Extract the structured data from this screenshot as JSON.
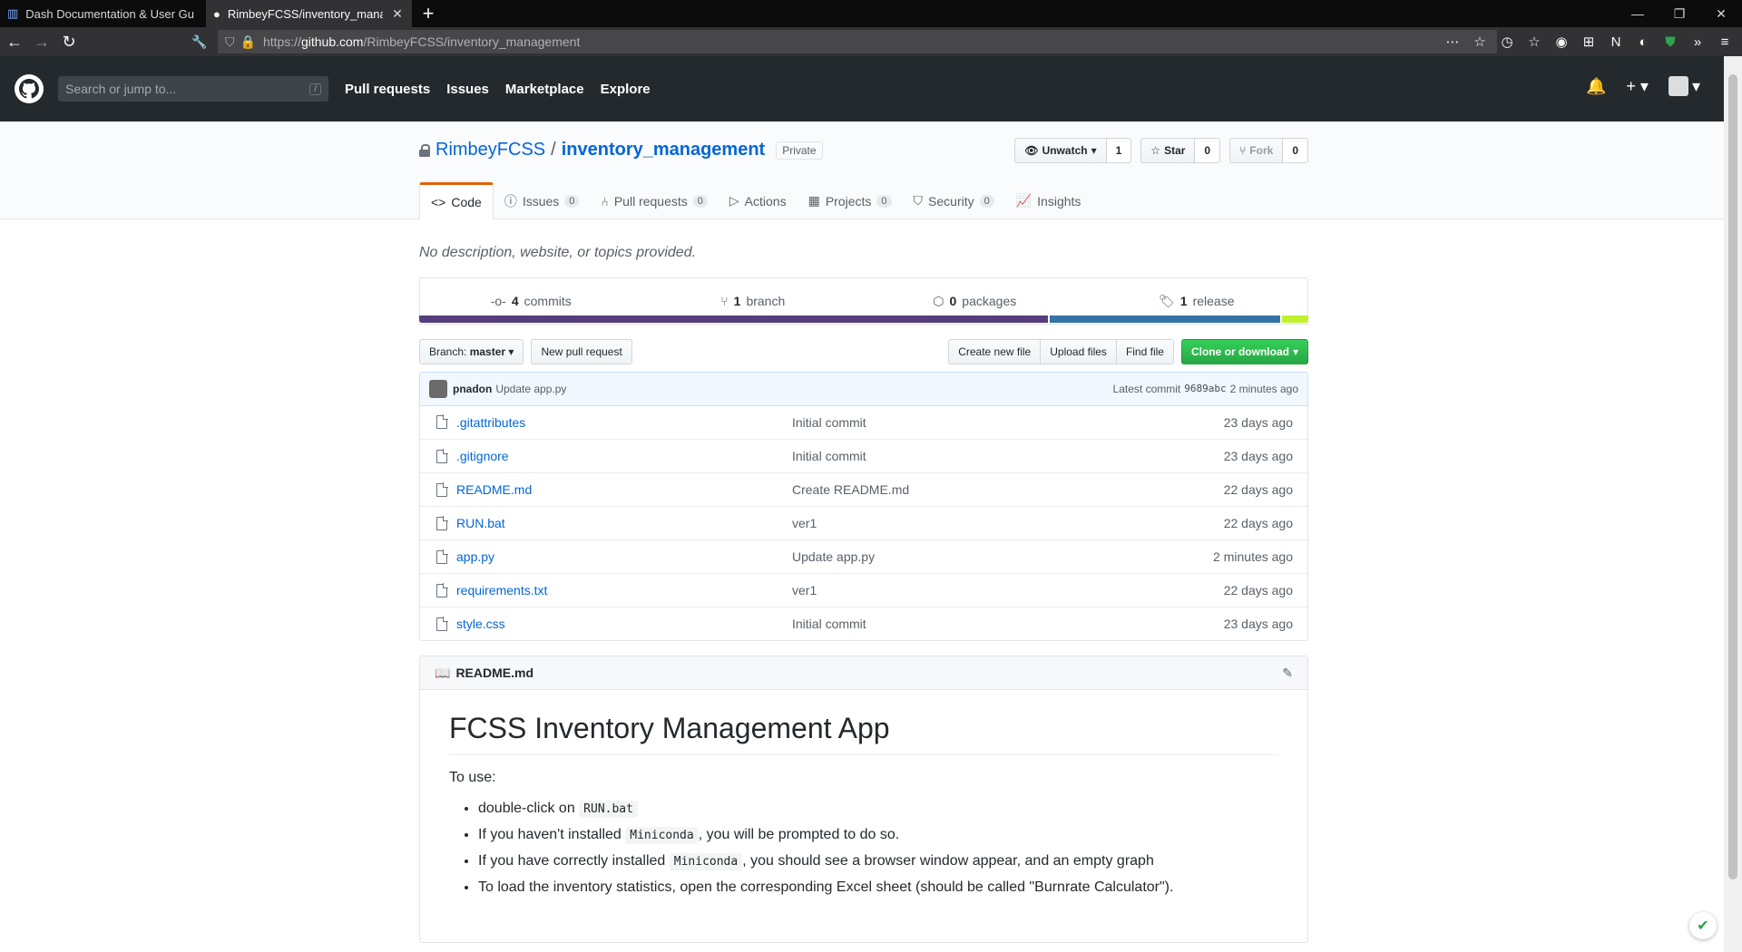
{
  "browser": {
    "tabs": [
      {
        "title": "Dash Documentation & User Gu",
        "active": false
      },
      {
        "title": "RimbeyFCSS/inventory_manag",
        "active": true
      }
    ],
    "url_prefix": "https://",
    "url_host": "github.com",
    "url_path": "/RimbeyFCSS/inventory_management"
  },
  "header": {
    "search_placeholder": "Search or jump to...",
    "search_key": "/",
    "nav": [
      "Pull requests",
      "Issues",
      "Marketplace",
      "Explore"
    ]
  },
  "repo": {
    "owner": "RimbeyFCSS",
    "name": "inventory_management",
    "visibility": "Private",
    "watch_label": "Unwatch",
    "watch_count": "1",
    "star_label": "Star",
    "star_count": "0",
    "fork_label": "Fork",
    "fork_count": "0",
    "tabs": [
      {
        "label": "Code",
        "count": null,
        "icon": "code-icon"
      },
      {
        "label": "Issues",
        "count": "0",
        "icon": "issue-icon"
      },
      {
        "label": "Pull requests",
        "count": "0",
        "icon": "pr-icon"
      },
      {
        "label": "Actions",
        "count": null,
        "icon": "play-icon"
      },
      {
        "label": "Projects",
        "count": "0",
        "icon": "project-icon"
      },
      {
        "label": "Security",
        "count": "0",
        "icon": "shield-icon"
      },
      {
        "label": "Insights",
        "count": null,
        "icon": "graph-icon"
      }
    ],
    "description": "No description, website, or topics provided."
  },
  "summary": {
    "commits_num": "4",
    "commits_label": "commits",
    "branch_num": "1",
    "branch_label": "branch",
    "packages_num": "0",
    "packages_label": "packages",
    "release_num": "1",
    "release_label": "release"
  },
  "languages": [
    {
      "color": "#563d7c",
      "percent": 71
    },
    {
      "color": "#3572A5",
      "percent": 26
    },
    {
      "color": "#C1F12E",
      "percent": 3
    }
  ],
  "toolbar": {
    "branch_prefix": "Branch:",
    "branch_name": "master",
    "new_pr": "New pull request",
    "create_file": "Create new file",
    "upload": "Upload files",
    "find": "Find file",
    "clone": "Clone or download"
  },
  "commit": {
    "author": "pnadon",
    "message": "Update app.py",
    "latest_label": "Latest commit",
    "sha": "9689abc",
    "age": "2 minutes ago"
  },
  "files": [
    {
      "name": ".gitattributes",
      "message": "Initial commit",
      "age": "23 days ago"
    },
    {
      "name": ".gitignore",
      "message": "Initial commit",
      "age": "23 days ago"
    },
    {
      "name": "README.md",
      "message": "Create README.md",
      "age": "22 days ago"
    },
    {
      "name": "RUN.bat",
      "message": "ver1",
      "age": "22 days ago"
    },
    {
      "name": "app.py",
      "message": "Update app.py",
      "age": "2 minutes ago"
    },
    {
      "name": "requirements.txt",
      "message": "ver1",
      "age": "22 days ago"
    },
    {
      "name": "style.css",
      "message": "Initial commit",
      "age": "23 days ago"
    }
  ],
  "readme": {
    "filename": "README.md",
    "title": "FCSS Inventory Management App",
    "intro": "To use:",
    "items": [
      {
        "before": "double-click on ",
        "code": "RUN.bat",
        "after": ""
      },
      {
        "before": "If you haven't installed ",
        "code": "Miniconda",
        "after": ", you will be prompted to do so."
      },
      {
        "before": "If you have correctly installed ",
        "code": "Miniconda",
        "after": ", you should see a browser window appear, and an empty graph"
      },
      {
        "before": "To load the inventory statistics, open the corresponding Excel sheet (should be called \"Burnrate Calculator\").",
        "code": "",
        "after": ""
      }
    ]
  }
}
